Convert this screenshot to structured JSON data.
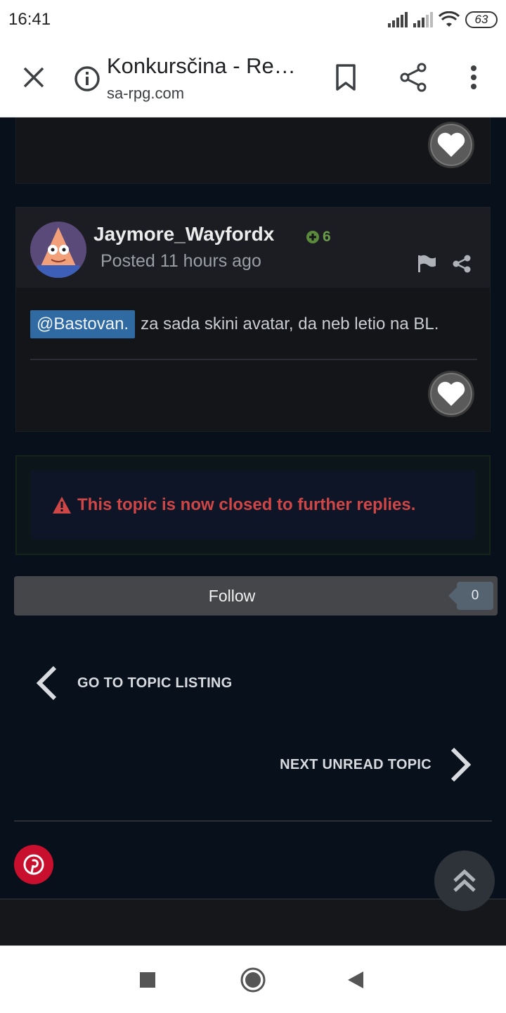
{
  "status_bar": {
    "time": "16:41",
    "battery": "63"
  },
  "browser": {
    "page_title": "Konkursčina - Re…",
    "domain": "sa-rpg.com"
  },
  "post": {
    "author": "Jaymore_Wayfordx",
    "reputation": "6",
    "posted": "Posted 11 hours ago",
    "mention": "@Bastovan.",
    "body": "za sada skini avatar, da neb letio na BL."
  },
  "closed_notice": "This topic is now closed to further replies.",
  "follow": {
    "label": "Follow",
    "count": "0"
  },
  "navigation": {
    "go_to_listing": "GO TO TOPIC LISTING",
    "next_unread": "NEXT UNREAD TOPIC"
  },
  "colors": {
    "page_background": "#08111b",
    "mention_background": "#2f6aa3",
    "reputation_green": "#6a9b4a",
    "closed_red": "#cf4646",
    "pinterest_red": "#c8102e"
  },
  "icons": [
    "close-icon",
    "info-icon",
    "bookmark-icon",
    "share-icon",
    "more-vert-icon",
    "heart-icon",
    "plus-circle-icon",
    "flag-icon",
    "warning-icon",
    "chevron-left-icon",
    "chevron-right-icon",
    "pinterest-icon",
    "double-chevron-up-icon",
    "recents-icon",
    "home-icon",
    "back-icon"
  ]
}
